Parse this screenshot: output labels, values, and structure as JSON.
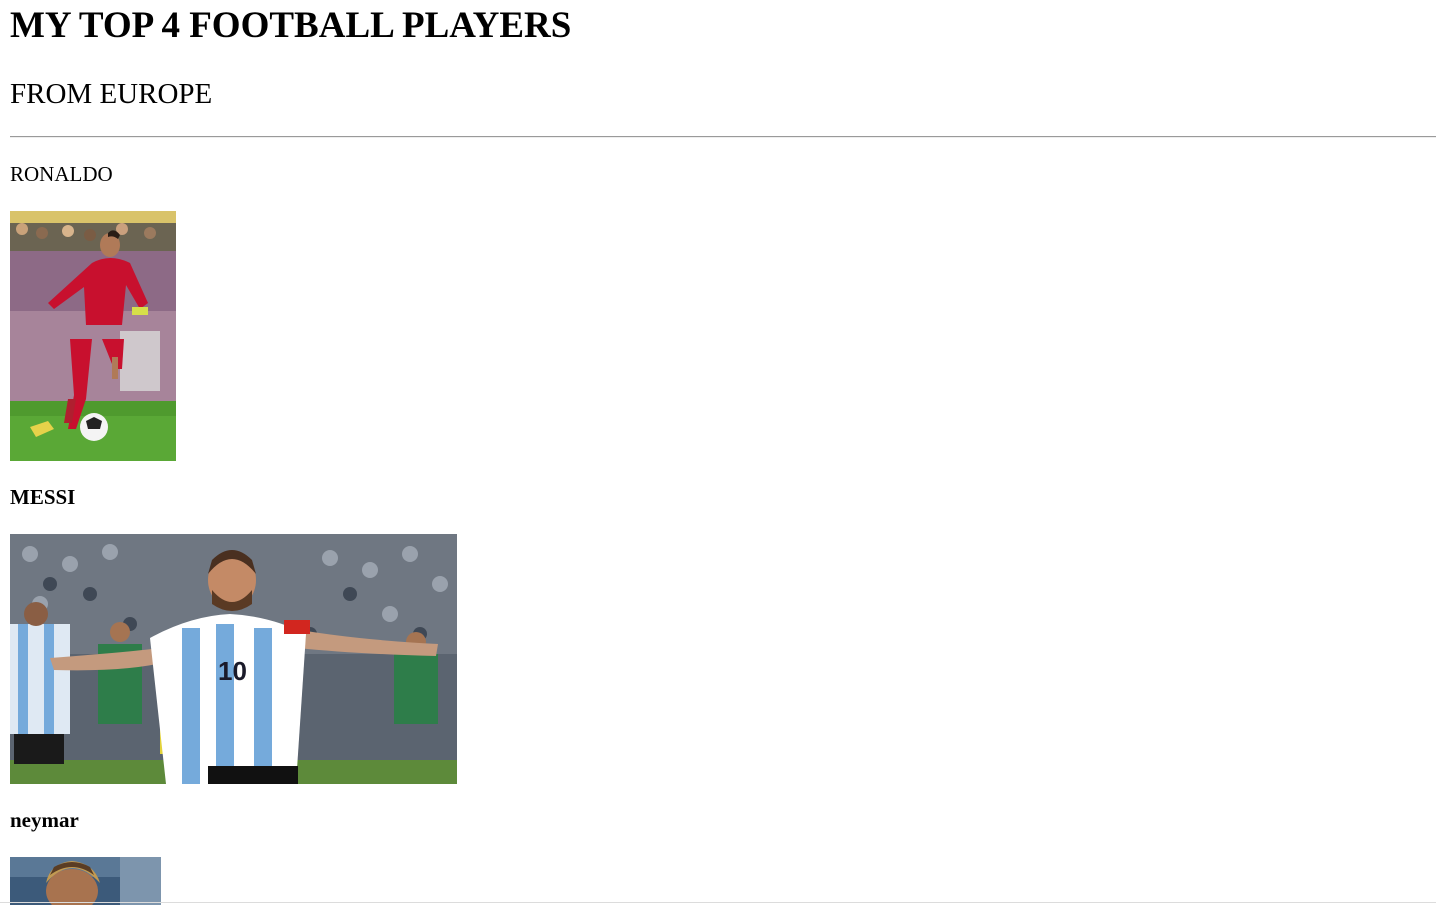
{
  "header": {
    "title": "MY TOP 4 FOOTBALL PLAYERS",
    "subtitle": "FROM EUROPE"
  },
  "players": [
    {
      "name": "RONALDO",
      "photo_icon": "ronaldo-photo"
    },
    {
      "name": "MESSI",
      "photo_icon": "messi-photo"
    },
    {
      "name": "neymar",
      "photo_icon": "neymar-photo"
    }
  ],
  "colors": {
    "text": "#000000",
    "background": "#ffffff",
    "divider": "#9a9a9a",
    "portugal_red": "#c8102e",
    "argentina_blue": "#75aadb",
    "pitch_green": "#4f9a2e"
  }
}
